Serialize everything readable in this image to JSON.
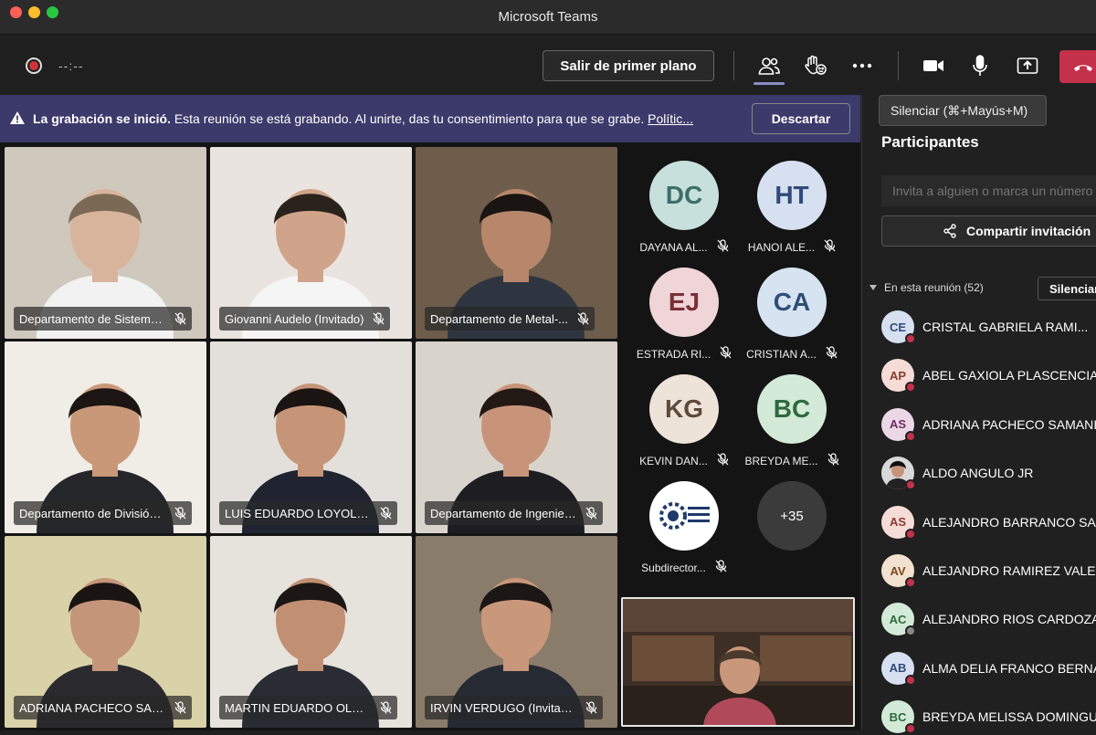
{
  "window": {
    "title": "Microsoft Teams"
  },
  "toolbar": {
    "timer": "--:--",
    "foreground_label": "Salir de primer plano",
    "mute_tooltip": "Silenciar (⌘+Mayús+M)"
  },
  "banner": {
    "bold": "La grabación se inició.",
    "text": " Esta reunión se está grabando. Al unirte, das tu consentimiento para que se grabe. ",
    "link": "Polític...",
    "dismiss": "Descartar"
  },
  "video_tiles": [
    {
      "label": "Departamento de Sistema...",
      "bg": "#cfc8bd",
      "skin": "#d9b49c",
      "shirt": "#f2f2f2",
      "hair": "#7a6a55"
    },
    {
      "label": "Giovanni Audelo (Invitado)",
      "bg": "#e9e4df",
      "skin": "#d0a48a",
      "shirt": "#f5f5f5",
      "hair": "#2a221d"
    },
    {
      "label": "Departamento de Metal-...",
      "bg": "#6e5d4a",
      "skin": "#b8876b",
      "shirt": "#2f3540",
      "hair": "#1a1512"
    },
    {
      "label": "Departamento de División de ...",
      "bg": "#f0ece6",
      "skin": "#c99878",
      "shirt": "#25262a",
      "hair": "#1b1614"
    },
    {
      "label": "LUIS EDUARDO LOYOLA S...",
      "bg": "#e3e0dc",
      "skin": "#c69577",
      "shirt": "#1f2430",
      "hair": "#1a1412"
    },
    {
      "label": "Departamento de Ingenier...",
      "bg": "#d8d4cc",
      "skin": "#c89479",
      "shirt": "#1e1e22",
      "hair": "#221914"
    },
    {
      "label": "ADRIANA PACHECO SAM...",
      "bg": "#d9d2a8",
      "skin": "#c5957a",
      "shirt": "#2a2a2e",
      "hair": "#1a1412"
    },
    {
      "label": "MARTIN EDUARDO OLMO...",
      "bg": "#e6e2dc",
      "skin": "#c19072",
      "shirt": "#2a2c33",
      "hair": "#1c1714"
    },
    {
      "label": "IRVIN VERDUGO (Invitado)",
      "bg": "#8a7c6a",
      "skin": "#c9977a",
      "shirt": "#262a33",
      "hair": "#1c1714"
    }
  ],
  "avatars": [
    {
      "initials": "DC",
      "name": "DAYANA AL...",
      "bg": "#c7e0dc",
      "fg": "#3c6e68"
    },
    {
      "initials": "HT",
      "name": "HANOI ALE...",
      "bg": "#d6e0f0",
      "fg": "#2f4a7a"
    },
    {
      "initials": "EJ",
      "name": "ESTRADA RI...",
      "bg": "#efd5d7",
      "fg": "#7a2f38"
    },
    {
      "initials": "CA",
      "name": "CRISTIAN A...",
      "bg": "#d6e4f2",
      "fg": "#2d4f77"
    },
    {
      "initials": "KG",
      "name": "KEVIN DAN...",
      "bg": "#ede3d9",
      "fg": "#5e4a3a"
    },
    {
      "initials": "BC",
      "name": "BREYDA ME...",
      "bg": "#d3ead8",
      "fg": "#2e6a3d"
    },
    {
      "initials": "",
      "name": "Subdirector...",
      "bg": "#ffffff",
      "fg": "#1e3a6b",
      "logo_text": "TECNOLÓGICO NACIONAL DE MÉXICO"
    },
    {
      "initials": "+35",
      "name": "",
      "bg": "#3b3b3b",
      "fg": "#ffffff"
    }
  ],
  "panel": {
    "title": "Participantes",
    "invite_placeholder": "Invita a alguien o marca un número",
    "share_label": "Compartir invitación",
    "section_label": "En esta reunión (52)",
    "mute_all": "Silenciar"
  },
  "participants": [
    {
      "initials": "CE",
      "name": "CRISTAL GABRIELA RAMI...",
      "bg": "#d6e0f0",
      "fg": "#2f4a7a",
      "status": "busy"
    },
    {
      "initials": "AP",
      "name": "ABEL GAXIOLA PLASCENCIA",
      "bg": "#f5dcd7",
      "fg": "#8a3b2f",
      "status": "busy"
    },
    {
      "initials": "AS",
      "name": "ADRIANA PACHECO SAMANIEGO",
      "bg": "#ecd7e6",
      "fg": "#6e2f5e",
      "status": "busy"
    },
    {
      "initials": "",
      "name": "ALDO ANGULO JR",
      "bg": "#444444",
      "fg": "#ffffff",
      "status": "busy",
      "photo": true
    },
    {
      "initials": "AS",
      "name": "ALEJANDRO BARRANCO SAINZ",
      "bg": "#f5dcd7",
      "fg": "#8a3b2f",
      "status": "busy"
    },
    {
      "initials": "AV",
      "name": "ALEJANDRO RAMIREZ VALENZUELA",
      "bg": "#f2e1cf",
      "fg": "#7a4a20",
      "status": "busy"
    },
    {
      "initials": "AC",
      "name": "ALEJANDRO RIOS CARDOZA",
      "bg": "#d3ead8",
      "fg": "#2e6a3d",
      "status": "away"
    },
    {
      "initials": "AB",
      "name": "ALMA DELIA FRANCO BERNAL",
      "bg": "#d6e0f0",
      "fg": "#2f4a7a",
      "status": "busy"
    },
    {
      "initials": "BC",
      "name": "BREYDA MELISSA DOMINGUEZ",
      "bg": "#d3ead8",
      "fg": "#2e6a3d",
      "status": "busy"
    }
  ]
}
